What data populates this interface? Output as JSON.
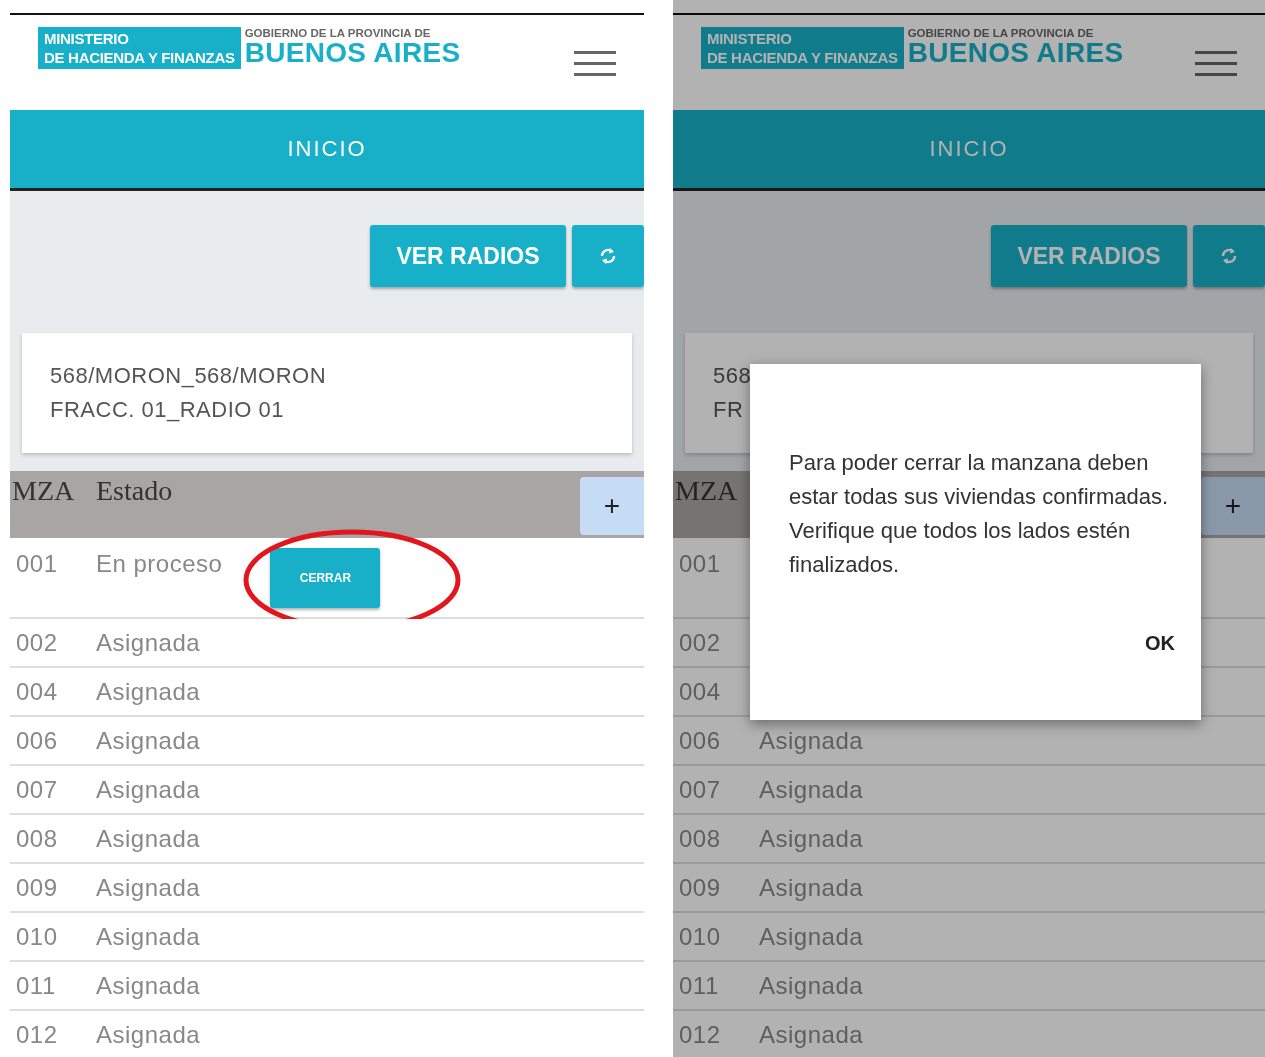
{
  "screens": [
    {
      "dimmed": false,
      "header": {
        "ministry_line1": "MINISTERIO",
        "ministry_line2": "DE HACIENDA Y FINANZAS",
        "government": "GOBIERNO DE LA PROVINCIA DE",
        "province": "BUENOS AIRES"
      },
      "nav": {
        "label": "INICIO"
      },
      "ver_radios": "VER RADIOS",
      "card": {
        "line1": "568/MORON_568/MORON",
        "line2": "FRACC. 01_RADIO 01"
      },
      "table": {
        "columns": [
          "MZA",
          "Estado"
        ],
        "add_button": "+",
        "rows": [
          {
            "mza": "001",
            "estado": "En proceso",
            "action": "CERRAR",
            "circled": true
          },
          {
            "mza": "002",
            "estado": "Asignada",
            "circled": false
          },
          {
            "mza": "004",
            "estado": "Asignada",
            "circled": false
          },
          {
            "mza": "006",
            "estado": "Asignada",
            "circled": false
          },
          {
            "mza": "007",
            "estado": "Asignada",
            "circled": false
          },
          {
            "mza": "008",
            "estado": "Asignada",
            "circled": false
          },
          {
            "mza": "009",
            "estado": "Asignada",
            "circled": false
          },
          {
            "mza": "010",
            "estado": "Asignada",
            "circled": false
          },
          {
            "mza": "011",
            "estado": "Asignada",
            "circled": false
          },
          {
            "mza": "012",
            "estado": "Asignada",
            "circled": false
          }
        ]
      }
    },
    {
      "dimmed": true,
      "header": {
        "ministry_line1": "MINISTERIO",
        "ministry_line2": "DE HACIENDA Y FINANZAS",
        "government": "GOBIERNO DE LA PROVINCIA DE",
        "province": "BUENOS AIRES"
      },
      "nav": {
        "label": "INICIO"
      },
      "ver_radios": "VER RADIOS",
      "card": {
        "line1": "568",
        "line2": "FR"
      },
      "table": {
        "columns": [
          "MZA"
        ],
        "add_button": "+",
        "rows": [
          {
            "mza": "001",
            "circled": false
          },
          {
            "mza": "002",
            "circled": false
          },
          {
            "mza": "004",
            "circled": false
          },
          {
            "mza": "006",
            "estado": "Asignada",
            "circled": false
          },
          {
            "mza": "007",
            "estado": "Asignada",
            "circled": false
          },
          {
            "mza": "008",
            "estado": "Asignada",
            "circled": false
          },
          {
            "mza": "009",
            "estado": "Asignada",
            "circled": false
          },
          {
            "mza": "010",
            "estado": "Asignada",
            "circled": false
          },
          {
            "mza": "011",
            "estado": "Asignada",
            "circled": false
          },
          {
            "mza": "012",
            "estado": "Asignada",
            "circled": false
          }
        ]
      },
      "dialog": {
        "message": "Para poder cerrar la manzana deben estar todas sus viviendas confirmadas. Verifique que todos los lados estén finalizados.",
        "button": "OK"
      }
    }
  ]
}
